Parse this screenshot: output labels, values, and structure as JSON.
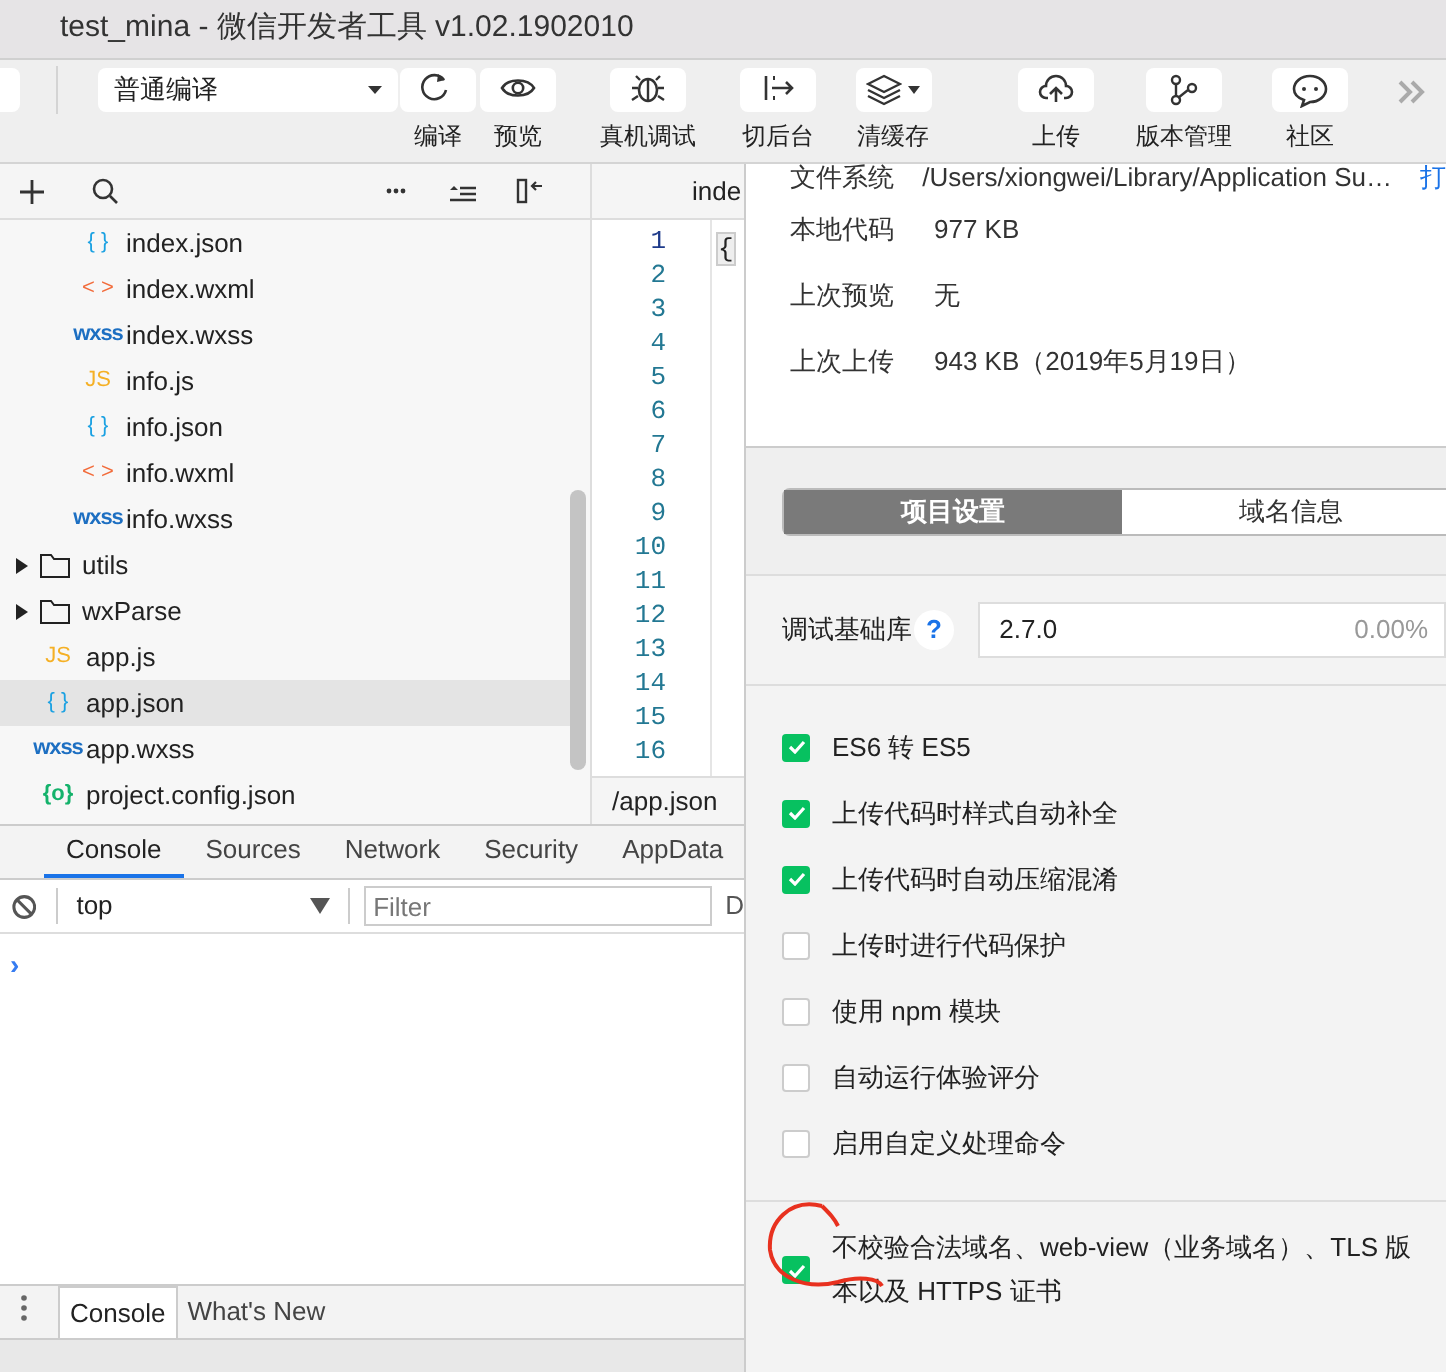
{
  "window": {
    "title": "test_mina - 微信开发者工具 v1.02.1902010"
  },
  "toolbar": {
    "compile_mode": "普通编译",
    "tools": [
      {
        "label": "编译"
      },
      {
        "label": "预览"
      },
      {
        "label": "真机调试"
      },
      {
        "label": "切后台"
      },
      {
        "label": "清缓存"
      },
      {
        "label": "上传"
      },
      {
        "label": "版本管理"
      },
      {
        "label": "社区"
      }
    ]
  },
  "file_tree": [
    {
      "children": [
        {
          "label": "index.json",
          "kind": "json",
          "icon": "{ }",
          "selected": false
        },
        {
          "label": "index.wxml",
          "kind": "wxml",
          "icon": "< >",
          "selected": false
        },
        {
          "label": "index.wxss",
          "kind": "wxss",
          "icon": "wxss",
          "selected": false
        },
        {
          "label": "info.js",
          "kind": "js",
          "icon": "JS",
          "selected": false
        },
        {
          "label": "info.json",
          "kind": "json",
          "icon": "{ }",
          "selected": false
        },
        {
          "label": "info.wxml",
          "kind": "wxml",
          "icon": "< >",
          "selected": false
        },
        {
          "label": "info.wxss",
          "kind": "wxss",
          "icon": "wxss",
          "selected": false
        }
      ]
    },
    {
      "label": "utils",
      "kind": "folder",
      "expanded": false,
      "selected": false
    },
    {
      "label": "wxParse",
      "kind": "folder",
      "expanded": false,
      "selected": false
    },
    {
      "label": "app.js",
      "kind": "js",
      "icon": "JS",
      "selected": false
    },
    {
      "label": "app.json",
      "kind": "json",
      "icon": "{ }",
      "selected": true
    },
    {
      "label": "app.wxss",
      "kind": "wxss",
      "icon": "wxss",
      "selected": false
    },
    {
      "label": "project.config.json",
      "kind": "config",
      "icon": "{o}",
      "selected": false
    }
  ],
  "editor": {
    "tab": "inde",
    "first_line": "{",
    "line_numbers": [
      "1",
      "2",
      "3",
      "4",
      "5",
      "6",
      "7",
      "8",
      "9",
      "10",
      "11",
      "12",
      "13",
      "14",
      "15",
      "16"
    ],
    "status_path": "/app.json"
  },
  "devtools": {
    "tabs": [
      {
        "label": "Console",
        "selected": true
      },
      {
        "label": "Sources",
        "selected": false
      },
      {
        "label": "Network",
        "selected": false
      },
      {
        "label": "Security",
        "selected": false
      },
      {
        "label": "AppData",
        "selected": false
      }
    ],
    "context": "top",
    "filter_placeholder": "Filter",
    "column_3": "D",
    "prompt": "›",
    "drawer_tabs": [
      {
        "label": "Console",
        "selected": true
      },
      {
        "label": "What's New",
        "selected": false
      }
    ]
  },
  "project_info": {
    "rows": [
      {
        "label": "文件系统",
        "value": "/Users/xiongwei/Library/Application Su…",
        "link": "打"
      },
      {
        "label": "本地代码",
        "value": "977 KB"
      },
      {
        "label": "上次预览",
        "value": "无"
      },
      {
        "label": "上次上传",
        "value": "943 KB（2019年5月19日）"
      }
    ]
  },
  "settings_tabs": [
    {
      "label": "项目设置",
      "selected": true
    },
    {
      "label": "域名信息",
      "selected": false
    }
  ],
  "base_library": {
    "label": "调试基础库",
    "help": "?",
    "version": "2.7.0",
    "usage": "0.00%"
  },
  "options": [
    {
      "label": "ES6 转 ES5",
      "checked": true
    },
    {
      "label": "上传代码时样式自动补全",
      "checked": true
    },
    {
      "label": "上传代码时自动压缩混淆",
      "checked": true
    },
    {
      "label": "上传时进行代码保护",
      "checked": false
    },
    {
      "label": "使用 npm 模块",
      "checked": false
    },
    {
      "label": "自动运行体验评分",
      "checked": false
    },
    {
      "label": "启用自定义处理命令",
      "checked": false
    }
  ],
  "domain_option": {
    "label": "不校验合法域名、web-view（业务域名）、TLS 版本以及 HTTPS 证书",
    "checked": true
  }
}
